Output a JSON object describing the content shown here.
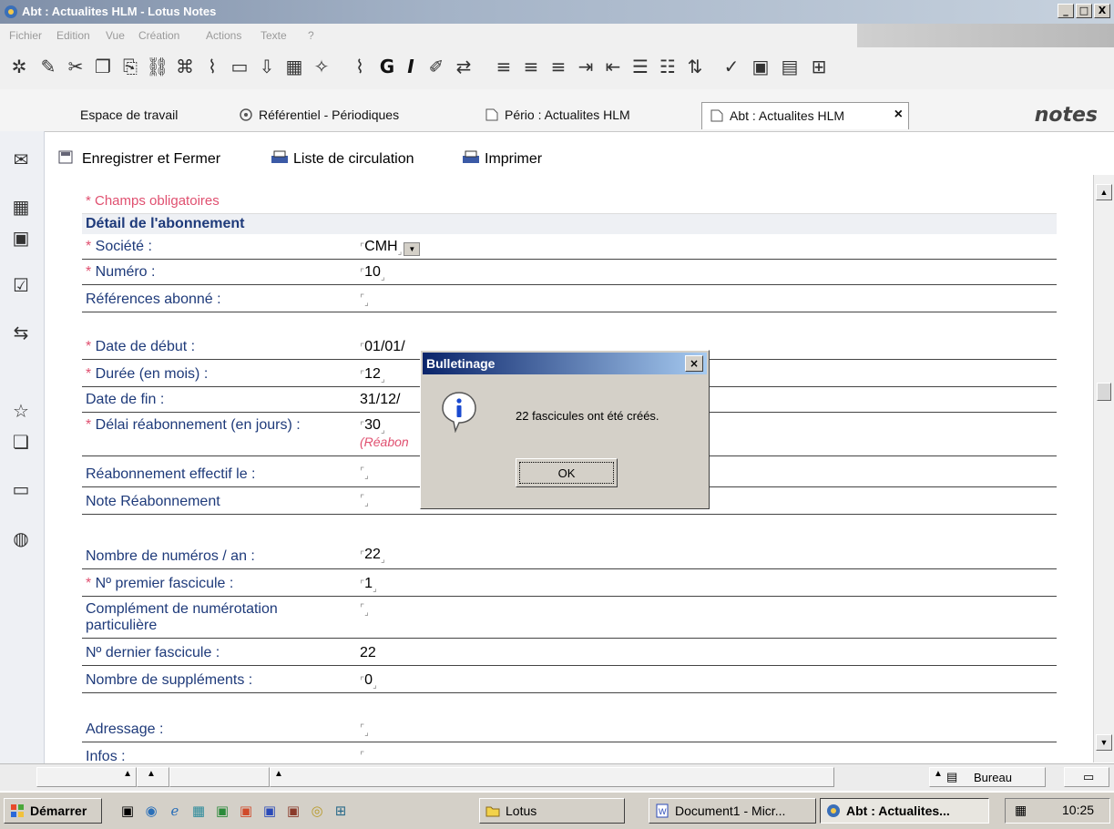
{
  "window": {
    "title": "Abt : Actualites HLM - Lotus Notes",
    "controls": [
      "_",
      "□",
      "X"
    ]
  },
  "menu": [
    "Fichier",
    "Edition",
    "Vue",
    "Création",
    "Actions",
    "Texte",
    "?"
  ],
  "toolbar_icons": [
    "cut-icon",
    "copy-icon",
    "paste-icon",
    "attach-icon",
    "bold-icon",
    "italic-icon",
    "align-left-icon",
    "align-center-icon",
    "align-right-icon",
    "bullet-list-icon",
    "number-list-icon",
    "spell-check-icon",
    "table-icon"
  ],
  "toolbar_glyphs": {
    "bold": "G",
    "italic": "I"
  },
  "tabs": [
    {
      "label": "Espace de travail"
    },
    {
      "label": "Référentiel - Périodiques"
    },
    {
      "label": "Pério : Actualites HLM"
    },
    {
      "label": "Abt : Actualites HLM",
      "close": "×"
    }
  ],
  "brand": "notes",
  "actions": {
    "save_close": "Enregistrer et Fermer",
    "circulation": "Liste de circulation",
    "print": "Imprimer"
  },
  "form": {
    "required_note": "* Champs obligatoires",
    "section_title": "Détail de l'abonnement",
    "star": "* ",
    "fields": {
      "societe": {
        "label": "Société :",
        "value": "CMH"
      },
      "numero": {
        "label": "Numéro :",
        "value": "10"
      },
      "references": {
        "label": "Références abonné :",
        "value": ""
      },
      "date_debut": {
        "label": "Date de début :",
        "value": "01/01/"
      },
      "duree": {
        "label": "Durée (en mois) :",
        "value": "12"
      },
      "date_fin": {
        "label": "Date de fin :",
        "value": "31/12/"
      },
      "delai": {
        "label": "Délai réabonnement (en jours) :",
        "value": "30",
        "note": "(Réabon"
      },
      "reabo_effectif": {
        "label": "Réabonnement effectif le :",
        "value": ""
      },
      "note_reabo": {
        "label": "Note Réabonnement",
        "value": ""
      },
      "nb_numeros": {
        "label": "Nombre de numéros / an :",
        "value": "22"
      },
      "premier_fasc": {
        "label": "Nº premier fascicule :",
        "value": "1"
      },
      "complement": {
        "label": "Complément de numérotation particulière",
        "value": ""
      },
      "dernier_fasc": {
        "label": "Nº dernier fascicule :",
        "value": "22"
      },
      "supplements": {
        "label": "Nombre de suppléments :",
        "value": "0"
      },
      "adressage": {
        "label": "Adressage :",
        "value": ""
      },
      "infos": {
        "label": "Infos :",
        "value": ""
      }
    }
  },
  "dialog": {
    "title": "Bulletinage",
    "close": "×",
    "message": "22 fascicules ont été créés.",
    "ok": "OK"
  },
  "statusbar": {
    "location": "Bureau"
  },
  "taskbar": {
    "start": "Démarrer",
    "items": [
      "Lotus",
      "Document1 - Micr...",
      "Abt : Actualites..."
    ],
    "clock": "10:25"
  },
  "colors": {
    "required": "#e05070",
    "label": "#1e3a7a",
    "dialog_title": "#0a246a"
  }
}
